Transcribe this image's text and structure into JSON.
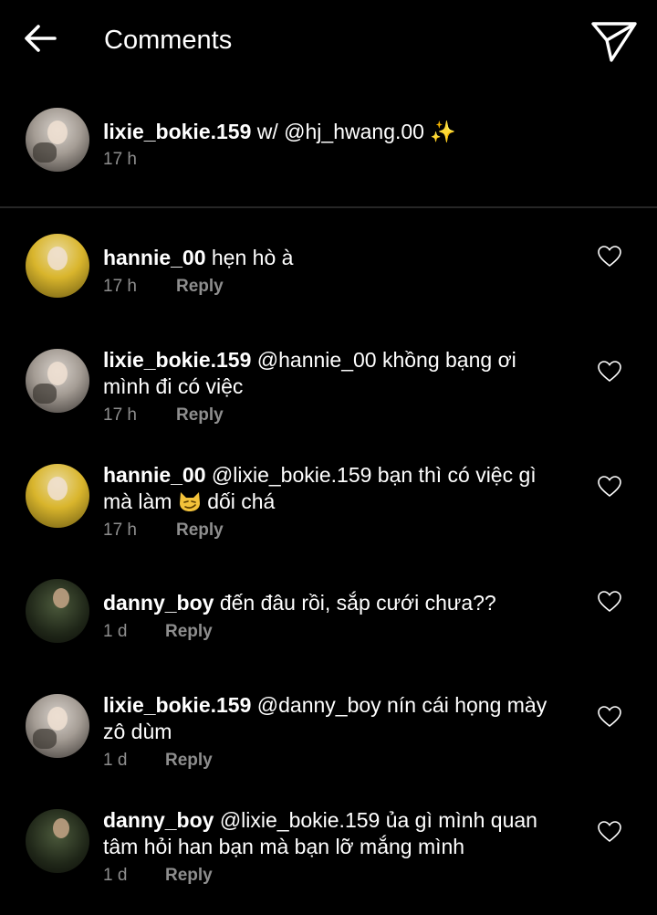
{
  "header": {
    "title": "Comments"
  },
  "caption": {
    "username": "lixie_bokie.159",
    "text": "w/ @hj_hwang.00",
    "emoji": "✨",
    "time": "17 h"
  },
  "comments": [
    {
      "username": "hannie_00",
      "text": "hẹn hò à",
      "time": "17 h",
      "reply": "Reply"
    },
    {
      "username": "lixie_bokie.159",
      "text": "@hannie_00 khồng bạng ơi mình đi có việc",
      "time": "17 h",
      "reply": "Reply"
    },
    {
      "username": "hannie_00",
      "text_before": "@lixie_bokie.159 bạn thì có việc gì mà làm",
      "text_after": "dối chá",
      "emoji": "smirking-cat",
      "time": "17 h",
      "reply": "Reply"
    },
    {
      "username": "danny_boy",
      "text": "đến đâu rồi, sắp cưới chưa??",
      "time": "1 d",
      "reply": "Reply"
    },
    {
      "username": "lixie_bokie.159",
      "text": "@danny_boy nín cái họng mày zô dùm",
      "time": "1 d",
      "reply": "Reply"
    },
    {
      "username": "danny_boy",
      "text": "@lixie_bokie.159 ủa gì mình quan tâm hỏi han bạn mà bạn lỡ mắng mình",
      "time": "1 d",
      "reply": "Reply"
    }
  ],
  "icons": {
    "back": "arrow-left-icon",
    "send": "paper-plane-icon",
    "like": "heart-outline-icon"
  },
  "colors": {
    "background": "#000000",
    "text": "#ffffff",
    "meta": "#8e8e8e",
    "divider": "#262626"
  }
}
